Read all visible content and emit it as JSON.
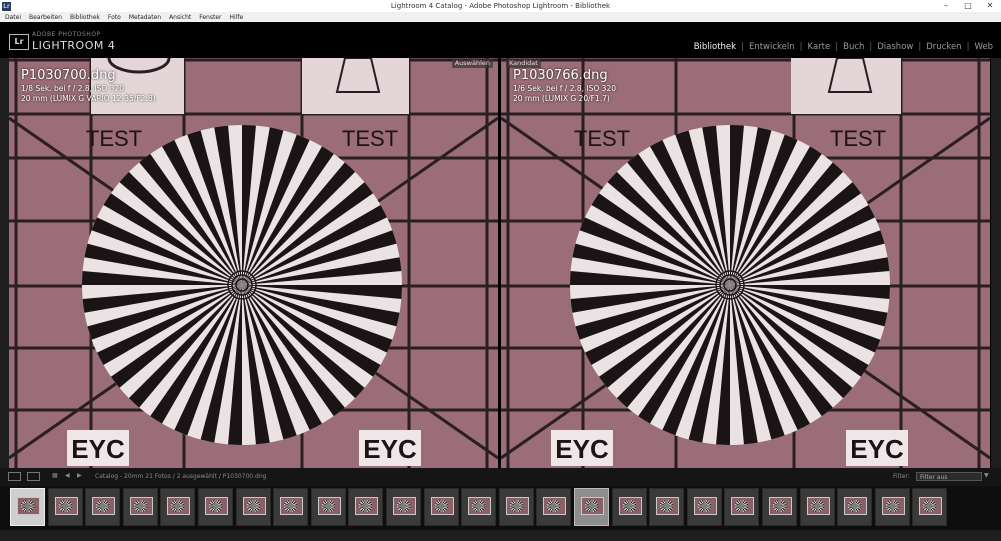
{
  "window": {
    "title": "Lightroom 4 Catalog - Adobe Photoshop Lightroom - Bibliothek",
    "app_icon": "Lr"
  },
  "menu": [
    "Datei",
    "Bearbeiten",
    "Bibliothek",
    "Foto",
    "Metadaten",
    "Ansicht",
    "Fenster",
    "Hilfe"
  ],
  "identity": {
    "badge": "Lr",
    "line1": "ADOBE PHOTOSHOP",
    "line2": "LIGHTROOM 4"
  },
  "modules": [
    "Bibliothek",
    "Entwickeln",
    "Karte",
    "Buch",
    "Diashow",
    "Drucken",
    "Web"
  ],
  "active_module": "Bibliothek",
  "compare": {
    "left": {
      "tag": "Auswählen",
      "filename": "P1030700.dng",
      "line1": "1/8 Sek. bei f / 2.8, ISO 320",
      "line2": "20 mm (LUMIX G VARIO 12-35/F2.8)",
      "chart_texts": [
        "TEST",
        "TEST",
        "EYC",
        "EYC"
      ]
    },
    "right": {
      "tag": "Kandidat",
      "filename": "P1030766.dng",
      "line1": "1/6 Sek. bei f / 2.8, ISO 320",
      "line2": "20 mm (LUMIX G 20/F1.7)",
      "chart_texts": [
        "TEST",
        "TEST",
        "EYC",
        "EYC"
      ]
    }
  },
  "toolbar": {
    "status": "Catalog - 20mm   21 Fotos / 2 ausgewählt / P1030700.dng",
    "filter_label": "Filter:",
    "filter_value": "Filter aus"
  },
  "filmstrip": {
    "count": 25,
    "selected_index": 0,
    "candidate_index": 15
  },
  "colors": {
    "chart_bg": "#9a6d78",
    "selected": "#cfcfcf",
    "accent_text": "#f2f2f2"
  },
  "icons": [
    "minimize-icon",
    "maximize-icon",
    "close-icon",
    "grid-view-icon",
    "back-arrow-icon",
    "forward-arrow-icon"
  ]
}
